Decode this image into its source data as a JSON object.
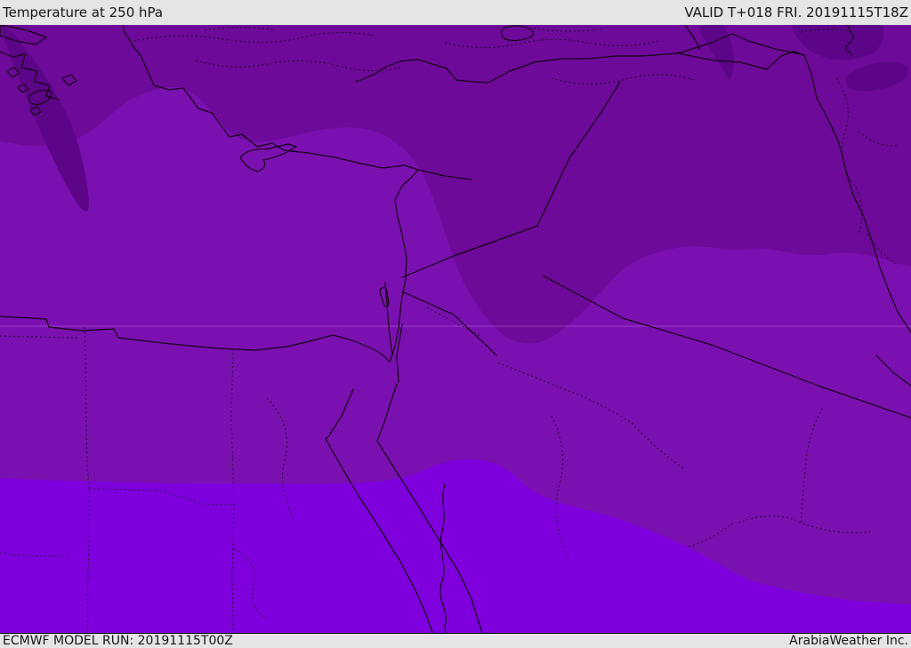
{
  "header": {
    "title": "Temperature at 250 hPa",
    "valid_label": "VALID T+018 FRI. 20191115T18Z"
  },
  "footer": {
    "model_run_label": "ECMWF MODEL RUN: 20191115T00Z",
    "credit_label": "ArabiaWeather Inc."
  },
  "map": {
    "kind": "temperature-shaded-weather-map",
    "region": "Eastern Mediterranean / Middle East / Egypt / Arabia",
    "colors": {
      "coldest_band": "#5c0588",
      "cold_band": "#6d0a99",
      "mid_band": "#7b10b1",
      "warm_band": "#7e00dd",
      "coastline": "#140014",
      "gridline": "#c77fe0",
      "bar_background": "#e6e4e6",
      "bar_text": "#161616"
    },
    "bands": [
      {
        "name": "coldest",
        "color": "#5c0588",
        "location": "small patches: Aegean streak, NE Turkey, Caspian corner"
      },
      {
        "name": "cold",
        "color": "#6d0a99",
        "location": "northern band over Turkey, Syria, Iraq with tongue into Jordan / N Saudi Arabia"
      },
      {
        "name": "mid",
        "color": "#7b10b1",
        "location": "broad central band: E Mediterranean, Levant, Egypt, central Arabia"
      },
      {
        "name": "warm",
        "color": "#7e00dd",
        "location": "southern band: southern Egypt, Sudan, southern Arabia"
      }
    ]
  }
}
